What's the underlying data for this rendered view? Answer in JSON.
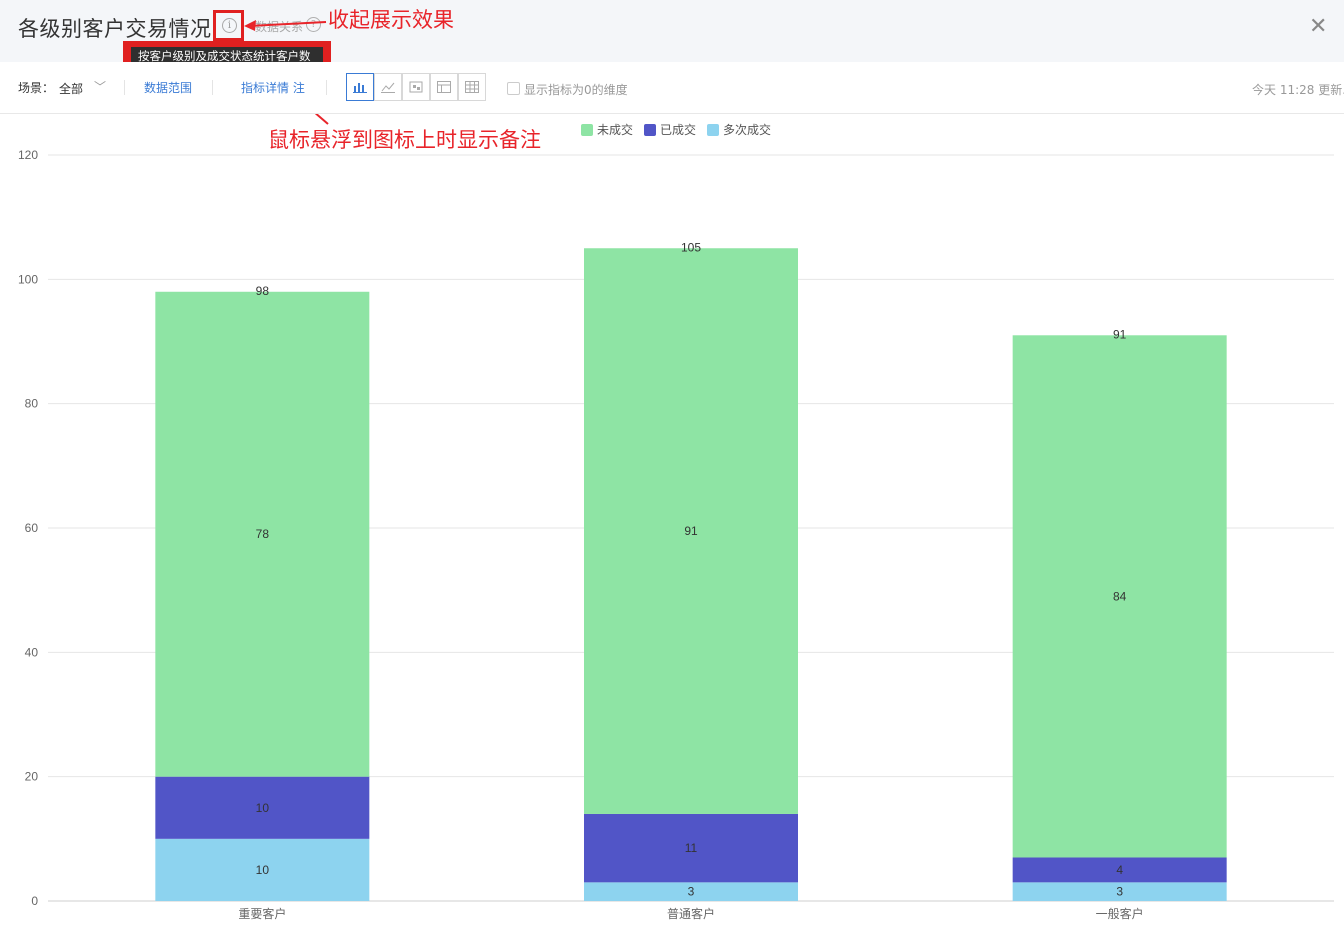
{
  "header": {
    "title": "各级别客户交易情况",
    "info_icon": "info-icon",
    "assoc_label": "数据关系",
    "help_icon": "question-icon",
    "close_icon": "close-icon",
    "tooltip": "按客户级别及成交状态统计客户数"
  },
  "annotations": {
    "collapse": "收起展示效果",
    "hover": "鼠标悬浮到图标上时显示备注"
  },
  "toolbar": {
    "scene_label": "场景：",
    "scene_value": "全部",
    "data_range": "数据范围",
    "metric_detail": "指标详情 注",
    "view_buttons": [
      {
        "icon": "bar-chart-icon",
        "active": true
      },
      {
        "icon": "line-chart-icon",
        "active": false
      },
      {
        "icon": "pivot-icon",
        "active": false
      },
      {
        "icon": "table-split-icon",
        "active": false
      },
      {
        "icon": "table-icon",
        "active": false
      }
    ],
    "show_zero_label": "显示指标为0的维度",
    "updated": "今天 11:28 更新."
  },
  "colors": {
    "accent": "#3a7bd5",
    "annotation": "#e8242a"
  },
  "chart_data": {
    "type": "bar",
    "stacked": true,
    "categories": [
      "重要客户",
      "普通客户",
      "一般客户"
    ],
    "series": [
      {
        "name": "多次成交",
        "color": "#8dd3ef",
        "values": [
          10,
          3,
          3
        ]
      },
      {
        "name": "已成交",
        "color": "#5155c7",
        "values": [
          10,
          11,
          4
        ]
      },
      {
        "name": "未成交",
        "color": "#8ee4a4",
        "values": [
          78,
          91,
          84
        ]
      }
    ],
    "totals": [
      98,
      105,
      91
    ],
    "legend_order": [
      "未成交",
      "已成交",
      "多次成交"
    ],
    "legend_position": "top",
    "ylim": [
      0,
      120
    ],
    "yticks": [
      0,
      20,
      40,
      60,
      80,
      100,
      120
    ],
    "grid": true
  }
}
